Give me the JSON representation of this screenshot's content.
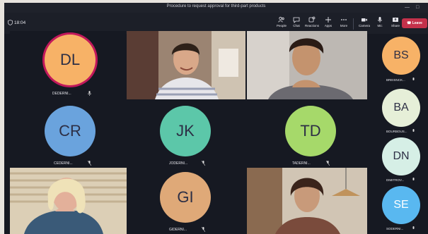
{
  "window": {
    "title": "Procedure to request approval for third-part products"
  },
  "toolbar": {
    "timer": "18:04",
    "buttons": [
      {
        "label": "People",
        "icon": "people-icon"
      },
      {
        "label": "Chat",
        "icon": "chat-icon"
      },
      {
        "label": "Reactions",
        "icon": "reactions-icon"
      },
      {
        "label": "Apps",
        "icon": "apps-icon"
      },
      {
        "label": "More",
        "icon": "more-icon"
      },
      {
        "label": "Camera",
        "icon": "camera-icon"
      },
      {
        "label": "Mic",
        "icon": "mic-icon"
      },
      {
        "label": "Share",
        "icon": "share-icon"
      }
    ],
    "leave_label": "Leave"
  },
  "participants": [
    {
      "initials": "DL",
      "name": "DEDERNI...",
      "color": "#f7b267",
      "speaking": true
    },
    {
      "initials": "CR",
      "name": "CEDERNI...",
      "color": "#6aa3dd"
    },
    {
      "initials": "JK",
      "name": "JODERNI...",
      "color": "#5cc7a9"
    },
    {
      "initials": "TD",
      "name": "TADERNI...",
      "color": "#a6d96a"
    },
    {
      "initials": "GI",
      "name": "GIDERNI...",
      "color": "#dfa978"
    }
  ],
  "sidebar": [
    {
      "initials": "BS",
      "name": "BREISNCK...",
      "color": "#f7b267"
    },
    {
      "initials": "BA",
      "name": "BOURBOUS...",
      "color": "#e6efd8"
    },
    {
      "initials": "DN",
      "name": "DIMITROV...",
      "color": "#d6efe6"
    },
    {
      "initials": "SE",
      "name": "SODERNI...",
      "color": "#59b8f0"
    }
  ],
  "colors": {
    "accent": "#c4314b",
    "background": "#161922",
    "speaking_ring": "#c2185b"
  }
}
